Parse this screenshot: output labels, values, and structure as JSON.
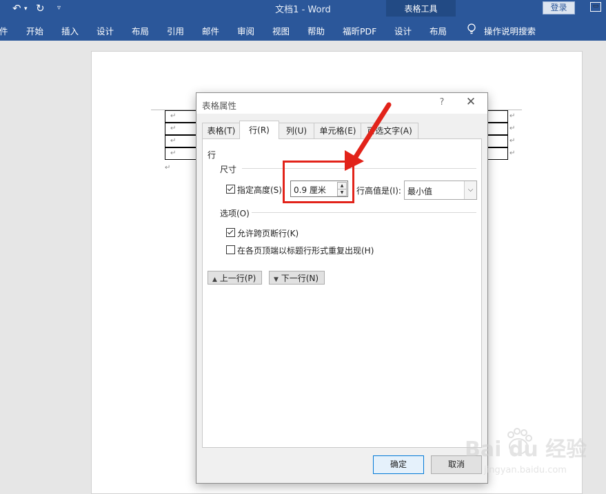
{
  "titlebar": {
    "doc_title": "文档1 - Word",
    "table_tools": "表格工具",
    "login": "登录"
  },
  "ribbon": {
    "tabs": [
      "件",
      "开始",
      "插入",
      "设计",
      "布局",
      "引用",
      "邮件",
      "审阅",
      "视图",
      "帮助",
      "福昕PDF"
    ],
    "tool_tabs": [
      "设计",
      "布局"
    ],
    "search": "操作说明搜索"
  },
  "dialog": {
    "title": "表格属性",
    "help": "?",
    "close": "✕",
    "tabs": [
      "表格(T)",
      "行(R)",
      "列(U)",
      "单元格(E)",
      "可选文字(A)"
    ],
    "active_tab": "行(R)",
    "section_row": "行",
    "group_size": "尺寸",
    "specify_height_label": "指定高度(S):",
    "specify_height_checked": true,
    "height_value": "0.9 厘米",
    "row_height_is_label": "行高值是(I):",
    "row_height_is_value": "最小值",
    "group_options": "选项(O)",
    "allow_break_label": "允许跨页断行(K)",
    "allow_break_checked": true,
    "repeat_header_label": "在各页顶端以标题行形式重复出现(H)",
    "repeat_header_checked": false,
    "prev_row": "上一行(P)",
    "next_row": "下一行(N)",
    "ok": "确定",
    "cancel": "取消"
  },
  "watermark": {
    "brand": "Bai du 经验",
    "url": "jingyan.baidu.com"
  },
  "colors": {
    "ribbon": "#2b579a",
    "highlight": "#e2231a"
  }
}
